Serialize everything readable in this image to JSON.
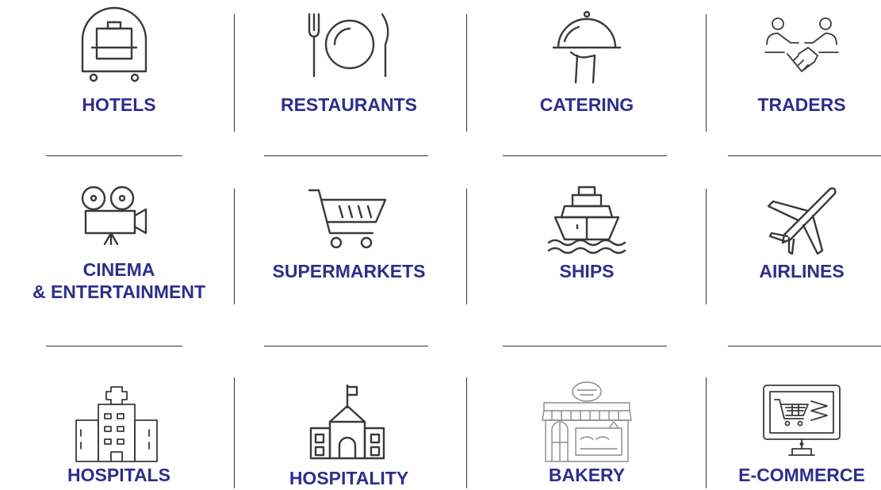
{
  "categories": {
    "hotels": {
      "label": "HOTELS",
      "icon": "luggage-cart-icon"
    },
    "restaurants": {
      "label": "RESTAURANTS",
      "icon": "plate-fork-knife-icon"
    },
    "catering": {
      "label": "CATERING",
      "icon": "serving-cloche-icon"
    },
    "traders": {
      "label": "TRADERS",
      "icon": "handshake-icon"
    },
    "cinema": {
      "label_line1": "CINEMA",
      "label_line2": "& ENTERTAINMENT",
      "icon": "film-camera-icon"
    },
    "supermarkets": {
      "label": "SUPERMARKETS",
      "icon": "shopping-cart-icon"
    },
    "ships": {
      "label": "SHIPS",
      "icon": "ship-icon"
    },
    "airlines": {
      "label": "AIRLINES",
      "icon": "airplane-icon"
    },
    "hospitals": {
      "label": "HOSPITALS",
      "icon": "hospital-icon"
    },
    "hospitality": {
      "label": "HOSPITALITY",
      "icon": "building-flag-icon"
    },
    "bakery": {
      "label": "BAKERY",
      "icon": "bakery-shop-icon"
    },
    "ecommerce": {
      "label": "E-COMMERCE",
      "icon": "computer-cart-icon"
    }
  },
  "colors": {
    "label": "#2e2e8c",
    "icon_stroke": "#3a3a3a",
    "divider": "#333333"
  }
}
